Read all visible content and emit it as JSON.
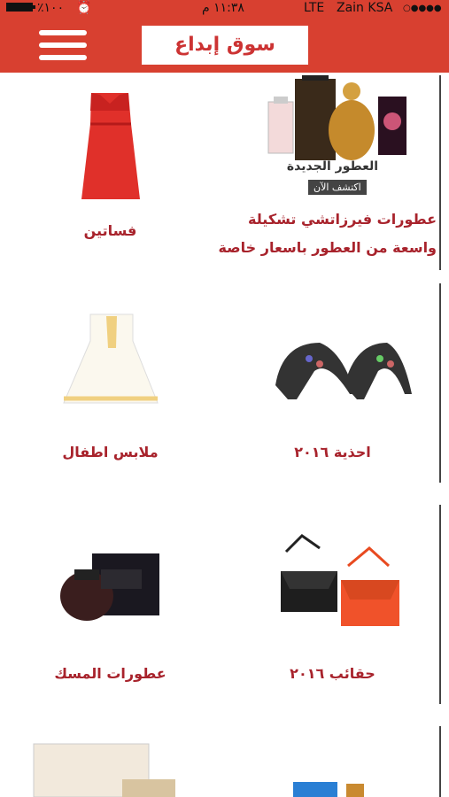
{
  "status": {
    "battery": "٪١٠٠",
    "time": "١١:٣٨ م",
    "carrier": "Zain KSA",
    "network": "LTE"
  },
  "header": {
    "title": "سوق إبداع"
  },
  "banner": {
    "caption": "العطور الجديدة",
    "cta": "اكتشف الآن"
  },
  "promo": {
    "line1": "عطورات فيرزاتشي تشكيلة",
    "line2": "واسعة من العطور باسعار خاصة"
  },
  "categories": [
    {
      "label": "فساتين",
      "icon": "red-dress-image"
    },
    {
      "label": "احذية ٢٠١٦",
      "icon": "shoes-image"
    },
    {
      "label": "ملابس اطفال",
      "icon": "kids-dress-image"
    },
    {
      "label": "حقائب ٢٠١٦",
      "icon": "handbags-image"
    },
    {
      "label": "عطورات المسك",
      "icon": "perfume-box-image"
    }
  ],
  "colors": {
    "brand": "#d84030",
    "text": "#a8232c"
  }
}
